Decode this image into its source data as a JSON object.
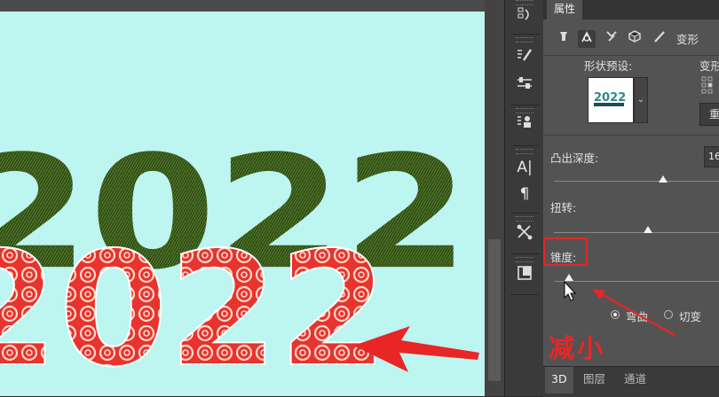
{
  "canvas": {
    "artwork_text": "2022",
    "background_color": "#bdf5f0",
    "fill_color": "#e8332e",
    "extrusion_texture_color": "#2f4a18"
  },
  "toolstrip": {
    "tools": [
      {
        "name": "history-tool",
        "icon": "history-icon"
      },
      {
        "name": "brush-settings-tool",
        "icon": "brush-settings-icon"
      },
      {
        "name": "adjustments-tool",
        "icon": "adjustments-icon"
      },
      {
        "name": "clone-source-tool",
        "icon": "clone-source-icon"
      },
      {
        "name": "character-tool",
        "icon": "character-icon",
        "glyph": "A|"
      },
      {
        "name": "paragraph-tool",
        "icon": "paragraph-icon",
        "glyph": "¶"
      },
      {
        "name": "tool-presets",
        "icon": "tool-presets-icon"
      },
      {
        "name": "layer-comps-tool",
        "icon": "layer-comps-icon"
      }
    ]
  },
  "properties": {
    "tab_title": "属性",
    "icons": [
      "scene-icon",
      "mesh-icon",
      "deform-icon",
      "cap-icon",
      "coordinates-icon"
    ],
    "deform_label": "变形",
    "shape_preset_label": "形状预设:",
    "deform_axis_label": "变形",
    "reset_button": "重",
    "extrusion_depth_label": "凸出深度:",
    "extrusion_depth_value": "16",
    "extrusion_depth_position": 0.66,
    "twist_label": "扭转:",
    "twist_position": 0.57,
    "taper_label": "锥度:",
    "taper_position": 0.09,
    "radio_bend": "弯曲",
    "radio_shear": "切变",
    "selected_radio": "弯曲"
  },
  "bottom_tabs": [
    "3D",
    "图层",
    "通道"
  ],
  "annotation": {
    "caption": "减小",
    "color": "#e82626"
  }
}
